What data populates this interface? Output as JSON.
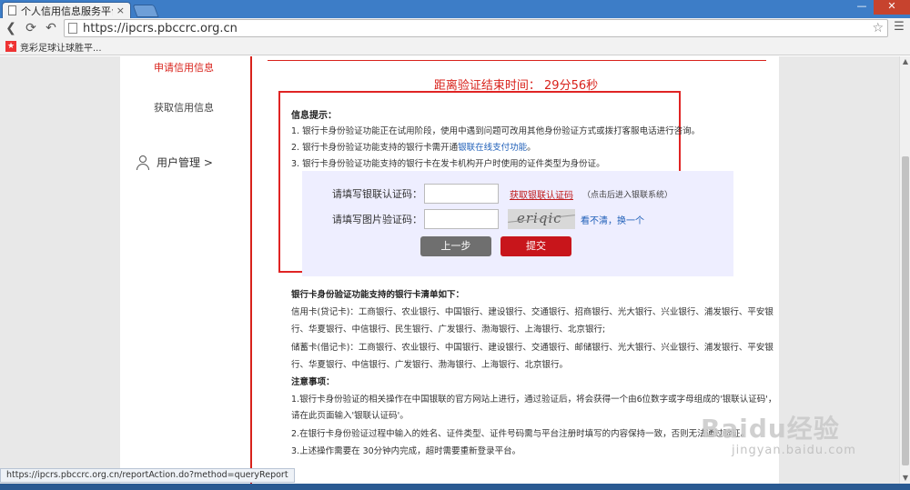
{
  "browser": {
    "tab_title": "个人信用信息服务平台",
    "tab_close": "×",
    "url": "https://ipcrs.pbccrc.org.cn",
    "bookmark_label": "竞彩足球让球胜平...",
    "status_url": "https://ipcrs.pbccrc.org.cn/reportAction.do?method=queryReport"
  },
  "sidebar": {
    "items": [
      {
        "label": "申请信用信息"
      },
      {
        "label": "获取信用信息"
      },
      {
        "label": "用户管理 >"
      }
    ]
  },
  "main": {
    "countdown": "距离验证结束时间： 29分56秒",
    "info": {
      "title": "信息提示：",
      "line1": "1. 银行卡身份验证功能正在试用阶段，使用中遇到问题可改用其他身份验证方式或拨打客服电话进行咨询。",
      "line2_pre": "2. 银行卡身份验证功能支持的银行卡需开通",
      "line2_link": "银联在线支付功能",
      "line2_post": "。",
      "line3": "3. 银行卡身份验证功能支持的银行卡在发卡机构开户时使用的证件类型为身份证。"
    },
    "form": {
      "unionpay_label": "请填写银联认证码：",
      "unionpay_value": "",
      "get_code_link": "获取银联认证码",
      "get_code_hint": "（点击后进入银联系统）",
      "captcha_label": "请填写图片验证码：",
      "captcha_value": "",
      "captcha_text": "eriqic",
      "refresh_link": "看不清，换一个",
      "back_button": "上一步",
      "submit_button": "提交"
    },
    "banks": {
      "header": "银行卡身份验证功能支持的银行卡清单如下：",
      "credit_1": "信用卡(贷记卡)：工商银行、农业银行、中国银行、建设银行、交通银行、招商银行、光大银行、兴业银行、浦发银行、平安银",
      "credit_2": "行、华夏银行、中信银行、民生银行、广发银行、渤海银行、上海银行、北京银行;",
      "debit_1": "储蓄卡(借记卡)：工商银行、农业银行、中国银行、建设银行、交通银行、邮储银行、光大银行、兴业银行、浦发银行、平安银",
      "debit_2": "行、华夏银行、中信银行、广发银行、渤海银行、上海银行、北京银行。",
      "notes_header": "注意事项：",
      "note1a": "1.银行卡身份验证的相关操作在中国银联的官方网站上进行，通过验证后，将会获得一个由6位数字或字母组成的'银联认证码'，",
      "note1b": "请在此页面输入'银联认证码'。",
      "note2": "2.在银行卡身份验证过程中输入的姓名、证件类型、证件号码需与平台注册时填写的内容保持一致，否则无法通过验证。",
      "note3": "3.上述操作需要在 30分钟内完成，超时需要重新登录平台。"
    }
  },
  "watermark": {
    "main": "Baidu经验",
    "sub": "jingyan.baidu.com"
  }
}
